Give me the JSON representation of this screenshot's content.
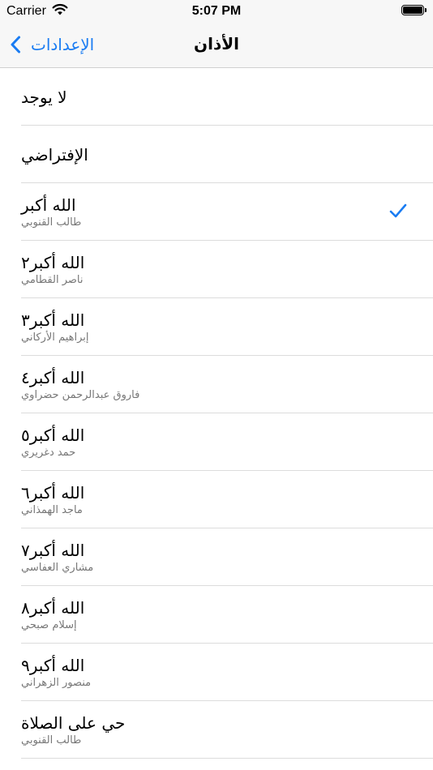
{
  "status_bar": {
    "carrier": "Carrier",
    "time": "5:07 PM"
  },
  "nav": {
    "back_label": "الإعدادات",
    "title": "الأذان"
  },
  "colors": {
    "accent": "#1a7cf2"
  },
  "items": [
    {
      "title": "لا يوجد",
      "subtitle": "",
      "selected": false
    },
    {
      "title": "الإفتراضي",
      "subtitle": "",
      "selected": false
    },
    {
      "title": "الله أكبر",
      "subtitle": "طالب القنوبي",
      "selected": true
    },
    {
      "title": "الله أكبر٢",
      "subtitle": "ناصر القطامي",
      "selected": false
    },
    {
      "title": "الله أكبر٣",
      "subtitle": "إبراهيم الأركاني",
      "selected": false
    },
    {
      "title": "الله أكبر٤",
      "subtitle": "فاروق عبدالرحمن حضراوي",
      "selected": false
    },
    {
      "title": "الله أكبر٥",
      "subtitle": "حمد دغريري",
      "selected": false
    },
    {
      "title": "الله أكبر٦",
      "subtitle": "ماجد الهمذاني",
      "selected": false
    },
    {
      "title": "الله أكبر٧",
      "subtitle": "مشاري العفاسي",
      "selected": false
    },
    {
      "title": "الله أكبر٨",
      "subtitle": "إسلام صبحي",
      "selected": false
    },
    {
      "title": "الله أكبر٩",
      "subtitle": "منصور الزهراني",
      "selected": false
    },
    {
      "title": "حي على الصلاة",
      "subtitle": "طالب القنوبي",
      "selected": false
    }
  ]
}
